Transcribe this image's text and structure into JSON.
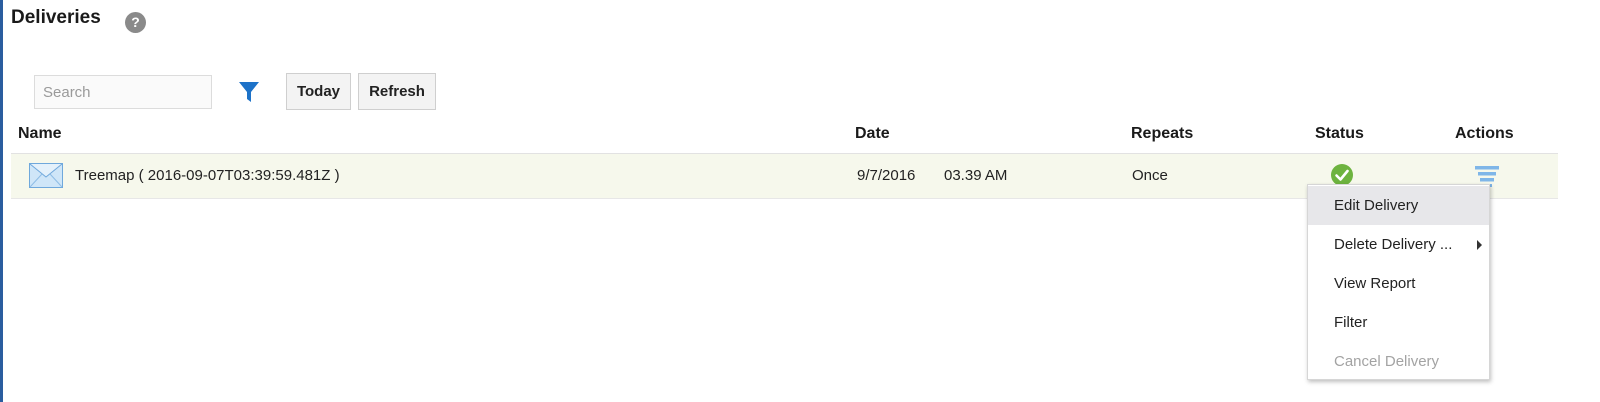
{
  "page": {
    "title": "Deliveries",
    "help_icon_glyph": "?"
  },
  "toolbar": {
    "search_placeholder": "Search",
    "search_value": "",
    "filter_icon": "funnel-icon",
    "today_label": "Today",
    "refresh_label": "Refresh"
  },
  "table": {
    "columns": [
      "Name",
      "Date",
      "Repeats",
      "Status",
      "Actions"
    ],
    "rows": [
      {
        "icon": "envelope-icon",
        "name": "Treemap ( 2016-09-07T03:39:59.481Z )",
        "date": "9/7/2016",
        "time": "03.39 AM",
        "repeats": "Once",
        "status_icon": "success-check-icon",
        "actions_icon": "actions-menu-icon"
      }
    ]
  },
  "context_menu": {
    "items": [
      {
        "label": "Edit Delivery",
        "highlighted": true,
        "enabled": true,
        "submenu": false
      },
      {
        "label": "Delete Delivery ...",
        "highlighted": false,
        "enabled": true,
        "submenu": true
      },
      {
        "label": "View Report",
        "highlighted": false,
        "enabled": true,
        "submenu": false
      },
      {
        "label": "Filter",
        "highlighted": false,
        "enabled": true,
        "submenu": false
      },
      {
        "label": "Cancel Delivery",
        "highlighted": false,
        "enabled": false,
        "submenu": false
      }
    ]
  },
  "colors": {
    "accent_blue": "#1d72c8",
    "row_highlight": "#f6f8ec",
    "status_green": "#6db33f",
    "menu_hover": "#e7e7ea",
    "disabled_text": "#a3a3a3"
  }
}
